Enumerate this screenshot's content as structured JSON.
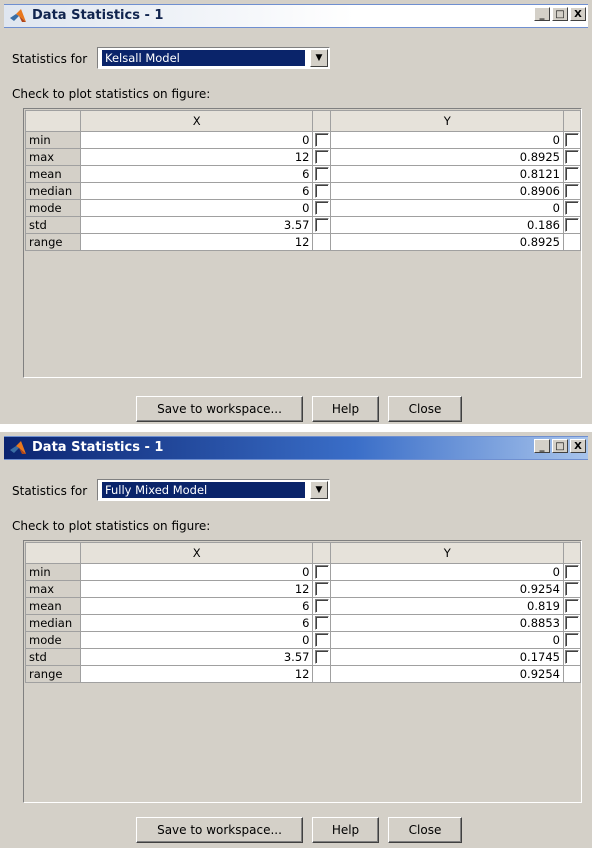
{
  "windows": [
    {
      "title": "Data Statistics - 1",
      "statistics_for_label": "Statistics for",
      "selected_model": "Kelsall Model",
      "check_label": "Check to plot statistics on figure:",
      "columns": [
        "X",
        "Y"
      ],
      "rows": [
        {
          "label": "min",
          "x": "0",
          "y": "0",
          "checkbox": true
        },
        {
          "label": "max",
          "x": "12",
          "y": "0.8925",
          "checkbox": true
        },
        {
          "label": "mean",
          "x": "6",
          "y": "0.8121",
          "checkbox": true
        },
        {
          "label": "median",
          "x": "6",
          "y": "0.8906",
          "checkbox": true
        },
        {
          "label": "mode",
          "x": "0",
          "y": "0",
          "checkbox": true
        },
        {
          "label": "std",
          "x": "3.57",
          "y": "0.186",
          "checkbox": true
        },
        {
          "label": "range",
          "x": "12",
          "y": "0.8925",
          "checkbox": false
        }
      ],
      "buttons": {
        "save": "Save to workspace...",
        "help": "Help",
        "close": "Close"
      }
    },
    {
      "title": "Data Statistics - 1",
      "statistics_for_label": "Statistics for",
      "selected_model": "Fully Mixed Model",
      "check_label": "Check to plot statistics on figure:",
      "columns": [
        "X",
        "Y"
      ],
      "rows": [
        {
          "label": "min",
          "x": "0",
          "y": "0",
          "checkbox": true
        },
        {
          "label": "max",
          "x": "12",
          "y": "0.9254",
          "checkbox": true
        },
        {
          "label": "mean",
          "x": "6",
          "y": "0.819",
          "checkbox": true
        },
        {
          "label": "median",
          "x": "6",
          "y": "0.8853",
          "checkbox": true
        },
        {
          "label": "mode",
          "x": "0",
          "y": "0",
          "checkbox": true
        },
        {
          "label": "std",
          "x": "3.57",
          "y": "0.1745",
          "checkbox": true
        },
        {
          "label": "range",
          "x": "12",
          "y": "0.9254",
          "checkbox": false
        }
      ],
      "buttons": {
        "save": "Save to workspace...",
        "help": "Help",
        "close": "Close"
      }
    }
  ],
  "titlebar_buttons": {
    "minimize": "_",
    "maximize": "□",
    "close": "X"
  },
  "colors": {
    "window_bg": "#d4d0c8",
    "selection_bg": "#0a246a",
    "active_title": "#0b2470"
  },
  "icons": {
    "app_icon": "matlab-logo-icon",
    "dropdown": "chevron-down-icon"
  }
}
